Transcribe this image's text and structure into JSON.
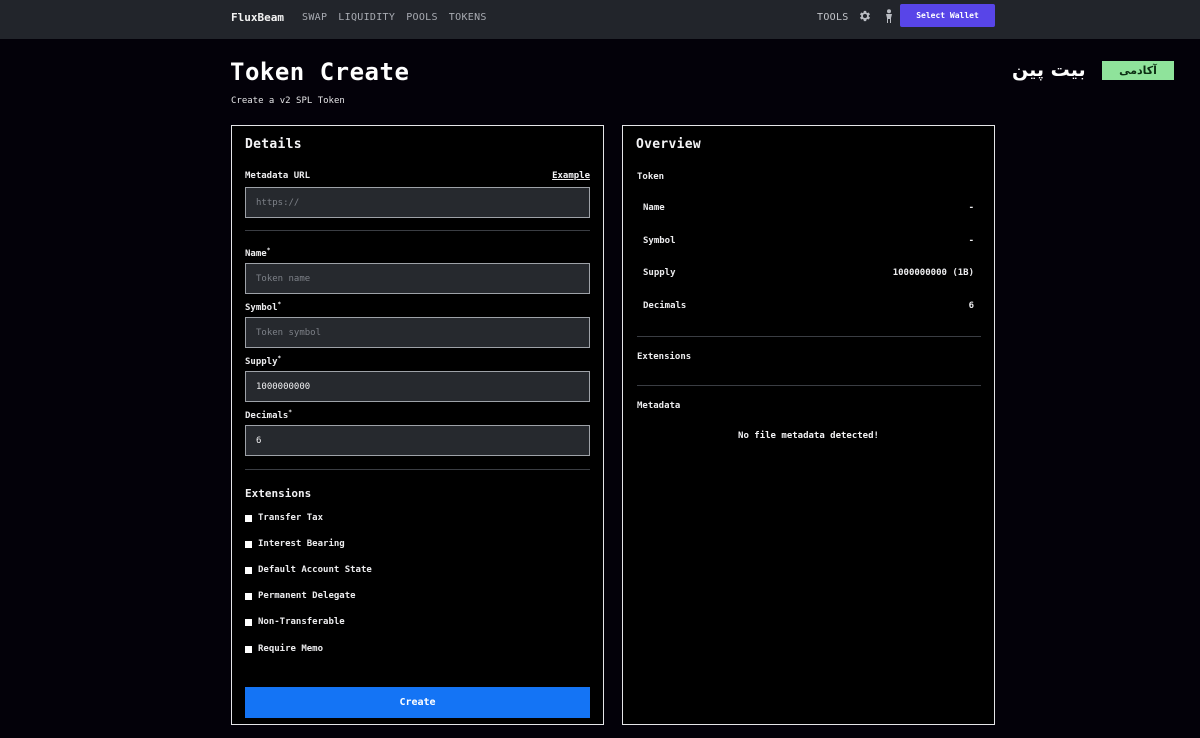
{
  "nav": {
    "brand": "FluxBeam",
    "links": [
      "SWAP",
      "LIQUIDITY",
      "POOLS",
      "TOKENS"
    ],
    "tools": "TOOLS",
    "wallet_button": "Select Wallet",
    "icons": {
      "settings": "gear-icon",
      "profile": "person-icon"
    },
    "colors": {
      "bar": "#22252b",
      "wallet_button": "#5845e8"
    }
  },
  "header": {
    "title": "Token Create",
    "subtitle": "Create a v2 SPL Token"
  },
  "watermark": {
    "script_text": "بیت پین",
    "badge_text": "آکادمی"
  },
  "details": {
    "title": "Details",
    "metadata_url": {
      "label": "Metadata URL",
      "example_link": "Example",
      "placeholder": "https://",
      "value": ""
    },
    "name": {
      "label": "Name",
      "required_mark": "*",
      "placeholder": "Token name",
      "value": ""
    },
    "symbol": {
      "label": "Symbol",
      "required_mark": "*",
      "placeholder": "Token symbol",
      "value": ""
    },
    "supply": {
      "label": "Supply",
      "required_mark": "*",
      "placeholder": "",
      "value": "1000000000"
    },
    "decimals": {
      "label": "Decimals",
      "required_mark": "*",
      "placeholder": "",
      "value": "6"
    },
    "extensions": {
      "title": "Extensions",
      "items": [
        {
          "label": "Transfer Tax",
          "checked": false
        },
        {
          "label": "Interest Bearing",
          "checked": false
        },
        {
          "label": "Default Account State",
          "checked": false
        },
        {
          "label": "Permanent Delegate",
          "checked": false
        },
        {
          "label": "Non-Transferable",
          "checked": false
        },
        {
          "label": "Require Memo",
          "checked": false
        }
      ]
    },
    "create_button": "Create",
    "colors": {
      "create_button": "#1474f5"
    }
  },
  "overview": {
    "title": "Overview",
    "token_section": "Token",
    "rows": [
      {
        "label": "Name",
        "value": "-"
      },
      {
        "label": "Symbol",
        "value": "-"
      },
      {
        "label": "Supply",
        "value": "1000000000 (1B)"
      },
      {
        "label": "Decimals",
        "value": "6"
      }
    ],
    "extensions_section": "Extensions",
    "metadata_section": "Metadata",
    "no_metadata_message": "No file metadata detected!"
  }
}
